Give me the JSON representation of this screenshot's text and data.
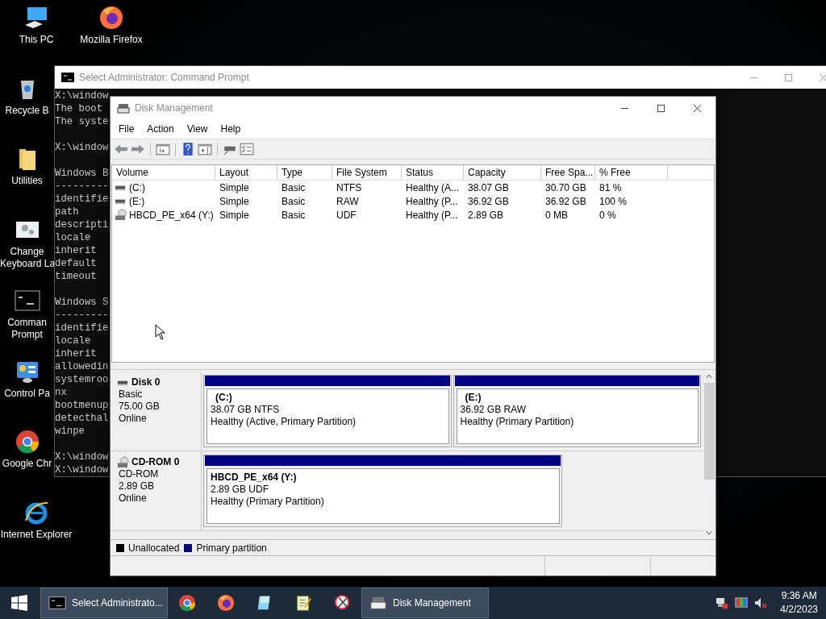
{
  "desktop_icons": [
    {
      "kind": "pc",
      "label": "This PC"
    },
    {
      "kind": "firefox",
      "label": "Mozilla Firefox"
    },
    {
      "kind": "recycle",
      "label": "Recycle B"
    },
    {
      "kind": "folder",
      "label": "Utilities"
    },
    {
      "kind": "keyboard",
      "label": "Change\nKeyboard La"
    },
    {
      "kind": "cmd",
      "label": "Comman\nPrompt"
    },
    {
      "kind": "control",
      "label": "Control Pa"
    },
    {
      "kind": "chrome",
      "label": "Google Chr"
    },
    {
      "kind": "ie",
      "label": "Internet Explorer"
    }
  ],
  "cmd_window": {
    "title": "Select Administrator: Command Prompt",
    "blocks": [
      [
        "X:\\window",
        "The boot",
        "The syste"
      ],
      [
        "X:\\window"
      ],
      [
        "Windows B",
        "---------",
        "identifie",
        "path",
        "descripti",
        "locale",
        "inherit",
        "default",
        "timeout"
      ],
      [
        "Windows S",
        "---------",
        "identifie",
        "locale",
        "inherit",
        "allowedin",
        "systemroo",
        "nx",
        "bootmenup",
        "detecthal",
        "winpe"
      ],
      [
        "X:\\window",
        "X:\\window"
      ]
    ]
  },
  "disk_management": {
    "title": "Disk Management",
    "menu": [
      "File",
      "Action",
      "View",
      "Help"
    ],
    "volumes": {
      "columns": [
        "Volume",
        "Layout",
        "Type",
        "File System",
        "Status",
        "Capacity",
        "Free Spa...",
        "% Free"
      ],
      "rows": [
        {
          "kind": "drive",
          "cells": [
            "(C:)",
            "Simple",
            "Basic",
            "NTFS",
            "Healthy (A...",
            "38.07 GB",
            "30.70 GB",
            "81 %"
          ]
        },
        {
          "kind": "drive",
          "cells": [
            "(E:)",
            "Simple",
            "Basic",
            "RAW",
            "Healthy (P...",
            "36.92 GB",
            "36.92 GB",
            "100 %"
          ]
        },
        {
          "kind": "cdrom",
          "cells": [
            "HBCD_PE_x64 (Y:)",
            "Simple",
            "Basic",
            "UDF",
            "Healthy (P...",
            "2.89 GB",
            "0 MB",
            "0 %"
          ]
        }
      ]
    },
    "disks": [
      {
        "kind": "drive",
        "name": "Disk 0",
        "type": "Basic",
        "size": "75.00 GB",
        "status": "Online",
        "partitions": [
          {
            "name": "(C:)",
            "detail": "38.07 GB NTFS",
            "status": "Healthy (Active, Primary Partition)"
          },
          {
            "name": "(E:)",
            "detail": "36.92 GB RAW",
            "status": "Healthy (Primary Partition)"
          }
        ]
      },
      {
        "kind": "cdrom",
        "name": "CD-ROM 0",
        "type": "CD-ROM",
        "size": "2.89 GB",
        "status": "Online",
        "partitions": [
          {
            "name": "HBCD_PE_x64  (Y:)",
            "detail": "2.89 GB UDF",
            "status": "Healthy (Primary Partition)"
          }
        ]
      }
    ],
    "legend": [
      {
        "label": "Unallocated",
        "color": "#000000"
      },
      {
        "label": "Primary partition",
        "color": "#000080"
      }
    ]
  },
  "taskbar": {
    "items": [
      {
        "kind": "cmd",
        "label": "Select Administrato...",
        "open": true
      },
      {
        "kind": "chrome",
        "open": false
      },
      {
        "kind": "firefox",
        "open": false
      },
      {
        "kind": "notepad",
        "open": false
      },
      {
        "kind": "editor",
        "open": false
      },
      {
        "kind": "snip",
        "open": false
      },
      {
        "kind": "disk",
        "label": "Disk Management",
        "open": true
      }
    ],
    "time": "9:36 AM",
    "date": "4/2/2023"
  }
}
